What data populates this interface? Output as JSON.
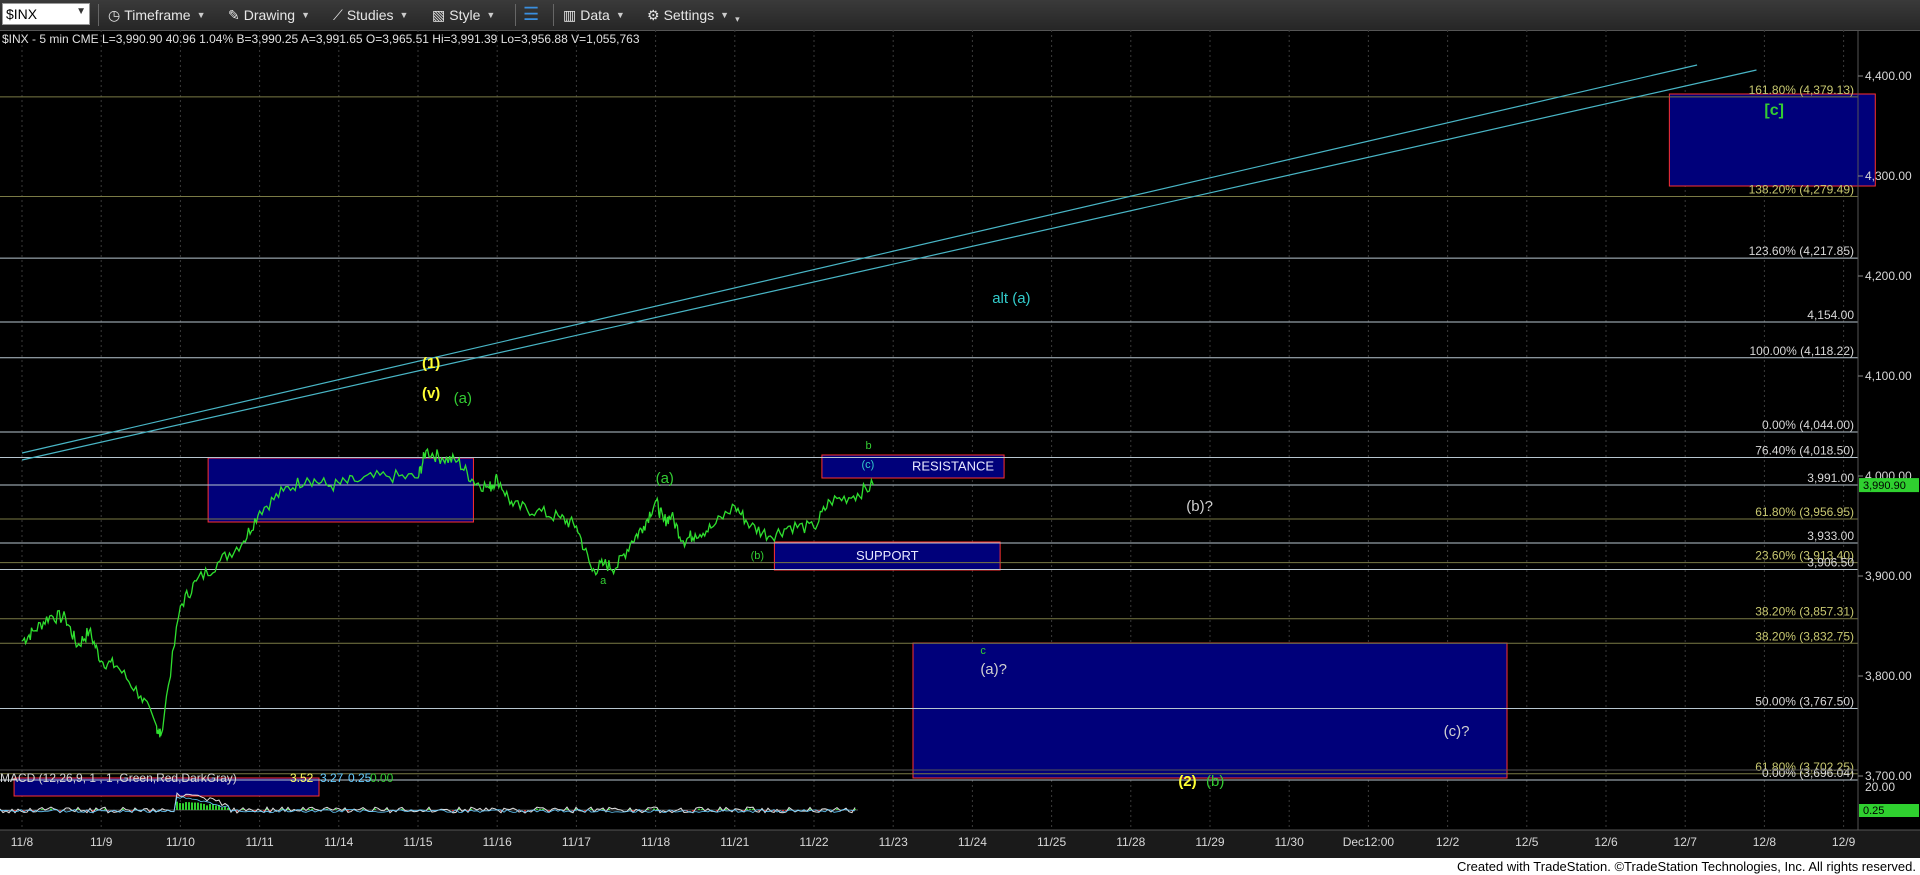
{
  "toolbar": {
    "symbol": "$INX",
    "timeframe": "Timeframe",
    "drawing": "Drawing",
    "studies": "Studies",
    "style": "Style",
    "data": "Data",
    "settings": "Settings"
  },
  "header_info": "$INX - 5 min  CME  L=3,990.90  40.96  1.04%  B=3,990.25  A=3,991.65  O=3,965.51  Hi=3,991.39  Lo=3,956.88  V=1,055,763",
  "footer": "Created with TradeStation. ©TradeStation Technologies, Inc. All rights reserved.",
  "colors": {
    "price": "#2fe02f",
    "fib_line": "#7a7a45",
    "level_line": "#b8c6d0",
    "box_fill": "#00007a",
    "box_border": "#ff3030",
    "trend_line": "#49b6c6",
    "label_yellow": "#ffff33",
    "label_green": "#33cc33",
    "label_cyan": "#33cccc"
  },
  "chart_data": {
    "type": "line",
    "title": "$INX - 5 min",
    "ylim": [
      3680,
      4420
    ],
    "x_ticks": [
      "11/8",
      "11/9",
      "11/10",
      "11/11",
      "11/14",
      "11/15",
      "11/16",
      "11/17",
      "11/18",
      "11/21",
      "11/22",
      "11/23",
      "11/24",
      "11/25",
      "11/28",
      "11/29",
      "11/30",
      "Dec12:00",
      "12/2",
      "12/5",
      "12/6",
      "12/7",
      "12/8",
      "12/9"
    ],
    "y_ticks": [
      {
        "value": 4400,
        "label": "4,400.00"
      },
      {
        "value": 4300,
        "label": "4,300.00"
      },
      {
        "value": 4200,
        "label": "4,200.00"
      },
      {
        "value": 4100,
        "label": "4,100.00"
      },
      {
        "value": 4000,
        "label": "4,000.00"
      },
      {
        "value": 3900,
        "label": "3,900.00"
      },
      {
        "value": 3800,
        "label": "3,800.00"
      },
      {
        "value": 3700,
        "label": "3,700.00"
      }
    ],
    "last_price": {
      "value": 3990.9,
      "label": "3,990.90"
    },
    "series": [
      {
        "name": "$INX",
        "points": [
          [
            0,
            3835
          ],
          [
            0.15,
            3845
          ],
          [
            0.35,
            3860
          ],
          [
            0.55,
            3858
          ],
          [
            0.7,
            3830
          ],
          [
            0.85,
            3845
          ],
          [
            1.0,
            3815
          ],
          [
            1.2,
            3810
          ],
          [
            1.5,
            3780
          ],
          [
            1.7,
            3750
          ],
          [
            1.75,
            3740
          ],
          [
            2.0,
            3870
          ],
          [
            2.2,
            3895
          ],
          [
            2.5,
            3915
          ],
          [
            2.8,
            3935
          ],
          [
            3.0,
            3965
          ],
          [
            3.3,
            3985
          ],
          [
            3.6,
            3998
          ],
          [
            3.9,
            3990
          ],
          [
            4.2,
            3995
          ],
          [
            4.6,
            4000
          ],
          [
            5.0,
            3998
          ],
          [
            5.1,
            4025
          ],
          [
            5.3,
            4018
          ],
          [
            5.5,
            4015
          ],
          [
            5.7,
            3995
          ],
          [
            5.9,
            3988
          ],
          [
            6.0,
            3998
          ],
          [
            6.2,
            3970
          ],
          [
            6.5,
            3965
          ],
          [
            6.8,
            3958
          ],
          [
            7.0,
            3950
          ],
          [
            7.2,
            3905
          ],
          [
            7.35,
            3912
          ],
          [
            7.5,
            3908
          ],
          [
            7.7,
            3935
          ],
          [
            7.85,
            3950
          ],
          [
            8.0,
            3975
          ],
          [
            8.1,
            3955
          ],
          [
            8.2,
            3960
          ],
          [
            8.35,
            3935
          ],
          [
            8.5,
            3942
          ],
          [
            8.7,
            3948
          ],
          [
            9.0,
            3970
          ],
          [
            9.2,
            3950
          ],
          [
            9.45,
            3940
          ],
          [
            9.7,
            3950
          ],
          [
            10.0,
            3948
          ],
          [
            10.2,
            3975
          ],
          [
            10.5,
            3980
          ],
          [
            10.75,
            3990.9
          ]
        ]
      }
    ],
    "horizontal_levels": [
      {
        "label": "161.80% (4,379.13)",
        "value": 4379.13,
        "kind": "fib"
      },
      {
        "label": "138.20% (4,279.49)",
        "value": 4279.49,
        "kind": "fib"
      },
      {
        "label": "123.60% (4,217.85)",
        "value": 4217.85,
        "kind": "level"
      },
      {
        "label": "4,154.00",
        "value": 4154,
        "kind": "level"
      },
      {
        "label": "100.00% (4,118.22)",
        "value": 4118.22,
        "kind": "level"
      },
      {
        "label": "0.00% (4,044.00)",
        "value": 4044,
        "kind": "level"
      },
      {
        "label": "76.40% (4,018.50)",
        "value": 4018.5,
        "kind": "level"
      },
      {
        "label": "3,991.00",
        "value": 3991,
        "kind": "level"
      },
      {
        "label": "61.80% (3,956.95)",
        "value": 3956.95,
        "kind": "fib"
      },
      {
        "label": "3,933.00",
        "value": 3933,
        "kind": "level"
      },
      {
        "label": "23.60% (3,913.40)",
        "value": 3913.4,
        "kind": "fib"
      },
      {
        "label": "3,906.50",
        "value": 3906.5,
        "kind": "level"
      },
      {
        "label": "38.20% (3,857.31)",
        "value": 3857.31,
        "kind": "fib"
      },
      {
        "label": "38.20% (3,832.75)",
        "value": 3832.75,
        "kind": "fib"
      },
      {
        "label": "50.00% (3,767.50)",
        "value": 3767.5,
        "kind": "level"
      },
      {
        "label": "61.80% (3,702.25)",
        "value": 3702.25,
        "kind": "fib"
      },
      {
        "label": "0.00% (3,696.04)",
        "value": 3696.04,
        "kind": "level"
      }
    ],
    "zones": [
      {
        "name": "upper-target",
        "x0": 20.8,
        "x1": 23.4,
        "y0": 4290,
        "y1": 4382,
        "label": ""
      },
      {
        "name": "resistance-zone",
        "x0": 10.1,
        "x1": 12.4,
        "y0": 3998,
        "y1": 4021,
        "label": "RESISTANCE"
      },
      {
        "name": "support-zone",
        "x0": 9.5,
        "x1": 12.35,
        "y0": 3906,
        "y1": 3934,
        "label": "SUPPORT"
      },
      {
        "name": "left-box",
        "x0": 2.35,
        "x1": 5.7,
        "y0": 3954,
        "y1": 4018,
        "label": ""
      },
      {
        "name": "lower-target",
        "x0": 11.25,
        "x1": 18.75,
        "y0": 3698,
        "y1": 3833,
        "label": ""
      },
      {
        "name": "bottom-left-box",
        "x0": -0.1,
        "x1": 3.75,
        "y0": 3680,
        "y1": 3698,
        "label": ""
      }
    ],
    "trend_lines": [
      {
        "x0": 0,
        "y0": 4023,
        "x1": 21.15,
        "y1": 4411
      },
      {
        "x0": 0,
        "y0": 4016,
        "x1": 21.9,
        "y1": 4406
      }
    ],
    "annotations": [
      {
        "text": "(1)",
        "x": 5.05,
        "y": 4108,
        "color": "yellow"
      },
      {
        "text": "(v)",
        "x": 5.05,
        "y": 4078,
        "color": "yellow"
      },
      {
        "text": "(a)",
        "x": 5.45,
        "y": 4073,
        "color": "green"
      },
      {
        "text": "alt (a)",
        "x": 12.25,
        "y": 4173,
        "color": "cyan"
      },
      {
        "text": "b",
        "x": 10.65,
        "y": 4027,
        "color": "green"
      },
      {
        "text": "(c)",
        "x": 10.6,
        "y": 4008,
        "color": "cyan"
      },
      {
        "text": "(a)",
        "x": 8.0,
        "y": 3993,
        "color": "green"
      },
      {
        "text": "(b)",
        "x": 9.2,
        "y": 3917,
        "color": "green"
      },
      {
        "text": "a",
        "x": 7.3,
        "y": 3892,
        "color": "green"
      },
      {
        "text": "(b)?",
        "x": 14.7,
        "y": 3965,
        "color": "white"
      },
      {
        "text": "c",
        "x": 12.1,
        "y": 3822,
        "color": "green"
      },
      {
        "text": "(a)?",
        "x": 12.1,
        "y": 3802,
        "color": "white"
      },
      {
        "text": "(c)?",
        "x": 17.95,
        "y": 3740,
        "color": "white"
      },
      {
        "text": "(2)",
        "x": 14.6,
        "y": 3690,
        "color": "yellow"
      },
      {
        "text": "(b)",
        "x": 14.95,
        "y": 3690,
        "color": "green"
      },
      {
        "text": "[c]",
        "x": 22.0,
        "y": 4361,
        "color": "green"
      }
    ]
  },
  "macd": {
    "label": "MACD (12,26,9, 1 , 1 ,Green,Red,DarkGray)",
    "v1": "3.52",
    "v2": "3.27",
    "v3": "0.25",
    "v4": "0.00",
    "axis_label": "20.00",
    "current_label": "0.25"
  }
}
